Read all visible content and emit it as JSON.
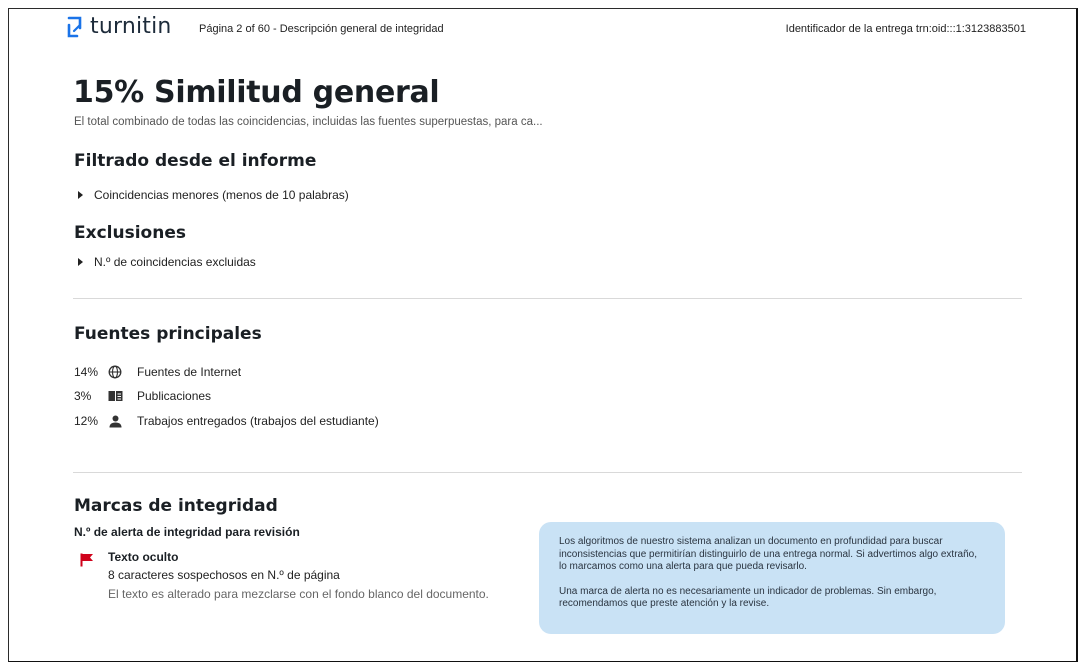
{
  "header": {
    "logo_text": "turnitin",
    "page_info": "Página 2 of 60 - Descripción general de integridad",
    "submission_id": "Identificador de la entrega trn:oid:::1:3123883501"
  },
  "overview": {
    "title": "15% Similitud general",
    "subtitle": "El total combinado de todas las coincidencias, incluidas las fuentes superpuestas, para ca..."
  },
  "filtered": {
    "heading": "Filtrado desde el informe",
    "items": [
      "Coincidencias menores (menos de 10 palabras)"
    ]
  },
  "exclusions": {
    "heading": "Exclusiones",
    "items": [
      "N.º de coincidencias excluidas"
    ]
  },
  "sources": {
    "heading": "Fuentes principales",
    "items": [
      {
        "pct": "14%",
        "icon": "globe-icon",
        "label": "Fuentes de Internet"
      },
      {
        "pct": "3%",
        "icon": "book-icon",
        "label": "Publicaciones"
      },
      {
        "pct": "12%",
        "icon": "person-icon",
        "label": "Trabajos entregados (trabajos del estudiante)"
      }
    ]
  },
  "integrity": {
    "heading": "Marcas de integridad",
    "subheading": "N.º de alerta de integridad para revisión",
    "flag": {
      "icon": "red-flag-icon",
      "title": "Texto oculto",
      "detail": "8 caracteres sospechosos en N.º de página",
      "description": "El texto es alterado para mezclarse con el fondo blanco del documento."
    },
    "info_paragraphs": [
      "Los algoritmos de nuestro sistema analizan un documento en profundidad para buscar inconsistencias que permitirían distinguirlo de una entrega normal. Si advertimos algo extraño, lo marcamos como una alerta para que pueda revisarlo.",
      "Una marca de alerta no es necesariamente un indicador de problemas. Sin embargo, recomendamos que preste atención y la revise."
    ]
  },
  "colors": {
    "accent_blue": "#1a73e8",
    "flag_red": "#d0021b",
    "info_box_bg": "#c9e2f5"
  }
}
